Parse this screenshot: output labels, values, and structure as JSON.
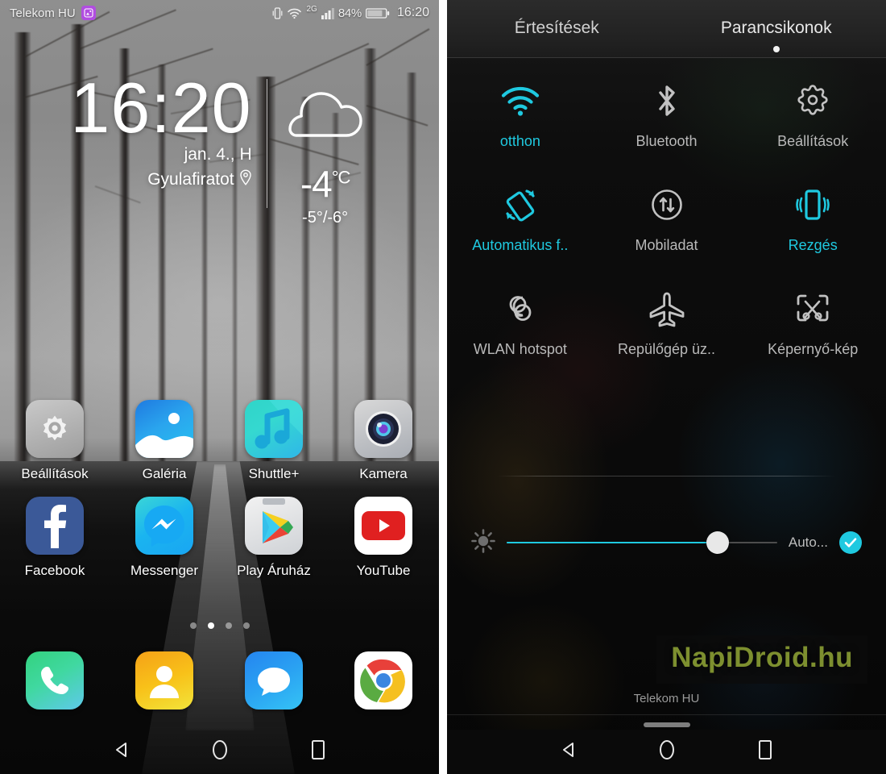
{
  "home": {
    "status_bar": {
      "carrier": "Telekom HU",
      "notification_icon": "image-notification-icon",
      "vibrate_icon": "vibrate-icon",
      "wifi_icon": "wifi-icon",
      "network_type": "2G",
      "signal_icon": "signal-bars-icon",
      "battery_percent": "84%",
      "battery_icon": "battery-icon",
      "time": "16:20"
    },
    "widget": {
      "clock": "16:20",
      "date": "jan. 4., H",
      "location": "Gyulafiratot",
      "location_icon": "location-pin-icon",
      "weather_icon": "cloud-icon",
      "temperature": "-4",
      "temperature_unit": "°C",
      "temperature_range": "-5°/-6°"
    },
    "apps": [
      [
        {
          "label": "Beállítások",
          "icon": "settings-gear-icon"
        },
        {
          "label": "Galéria",
          "icon": "gallery-photo-icon"
        },
        {
          "label": "Shuttle+",
          "icon": "music-note-icon"
        },
        {
          "label": "Kamera",
          "icon": "camera-lens-icon"
        }
      ],
      [
        {
          "label": "Facebook",
          "icon": "facebook-icon"
        },
        {
          "label": "Messenger",
          "icon": "messenger-icon"
        },
        {
          "label": "Play Áruház",
          "icon": "play-store-icon"
        },
        {
          "label": "YouTube",
          "icon": "youtube-icon"
        }
      ]
    ],
    "page_dots": {
      "count": 4,
      "active_index": 1
    },
    "dock": [
      {
        "label": "Telefon",
        "icon": "phone-handset-icon"
      },
      {
        "label": "Névjegyek",
        "icon": "contacts-person-icon"
      },
      {
        "label": "Üzenetek",
        "icon": "messages-bubble-icon"
      },
      {
        "label": "Chrome",
        "icon": "chrome-icon"
      }
    ],
    "nav": [
      {
        "name": "back",
        "icon": "back-triangle-icon"
      },
      {
        "name": "home",
        "icon": "home-circle-icon"
      },
      {
        "name": "recents",
        "icon": "recents-square-icon"
      }
    ]
  },
  "quick_settings": {
    "tabs": [
      {
        "label": "Értesítések",
        "active": false
      },
      {
        "label": "Parancsikonok",
        "active": true
      }
    ],
    "tiles": [
      [
        {
          "label": "otthon",
          "icon": "wifi-icon",
          "state": "on"
        },
        {
          "label": "Bluetooth",
          "icon": "bluetooth-icon",
          "state": "off"
        },
        {
          "label": "Beállítások",
          "icon": "settings-gear-icon",
          "state": "off"
        }
      ],
      [
        {
          "label": "Automatikus f..",
          "icon": "auto-rotate-icon",
          "state": "on"
        },
        {
          "label": "Mobiladat",
          "icon": "mobile-data-icon",
          "state": "off"
        },
        {
          "label": "Rezgés",
          "icon": "vibrate-icon",
          "state": "on"
        }
      ],
      [
        {
          "label": "WLAN hotspot",
          "icon": "hotspot-icon",
          "state": "off"
        },
        {
          "label": "Repülőgép üz..",
          "icon": "airplane-icon",
          "state": "off"
        },
        {
          "label": "Képernyő-kép",
          "icon": "screenshot-icon",
          "state": "off"
        }
      ]
    ],
    "brightness": {
      "icon": "brightness-sun-icon",
      "value_percent": 78,
      "auto_label": "Auto...",
      "auto_checked": true,
      "check_icon": "check-icon"
    },
    "watermark": "NapiDroid.hu",
    "carrier": "Telekom HU",
    "drag_handle": "drag-handle",
    "nav": [
      {
        "name": "back",
        "icon": "back-triangle-icon"
      },
      {
        "name": "home",
        "icon": "home-circle-icon"
      },
      {
        "name": "recents",
        "icon": "recents-square-icon"
      }
    ]
  },
  "colors": {
    "accent_cyan": "#1fc9e0",
    "tile_off": "#b9b9b9",
    "watermark_green": "#7d8f2f",
    "notification_purple": "#b14de0"
  }
}
